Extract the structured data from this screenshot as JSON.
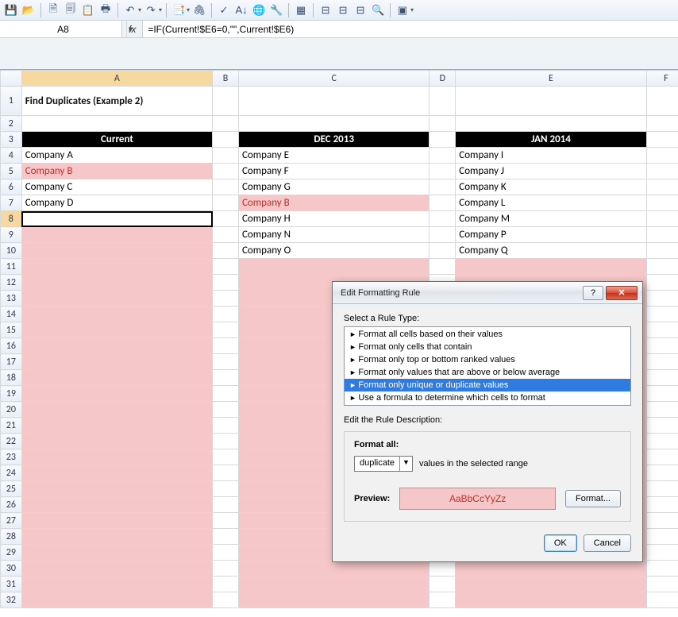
{
  "toolbar_icons": [
    "💾",
    "📂",
    "—",
    "📄",
    "📋",
    "📋",
    "🖨",
    "—",
    "↩",
    "↪",
    "—",
    "📑",
    "📎",
    "—",
    "✔",
    "🔤",
    "🌐",
    "🔧",
    "—",
    "🗂",
    "—",
    "🔗",
    "🔗",
    "🔀",
    "🔍",
    "—",
    "⬛"
  ],
  "name_box": "A8",
  "fx": "fx",
  "formula": "=IF(Current!$E6=0,\"\",Current!$E6)",
  "columns": [
    "A",
    "B",
    "C",
    "D",
    "E",
    "F"
  ],
  "rows": [
    "1",
    "2",
    "3",
    "4",
    "5",
    "6",
    "7",
    "8",
    "9",
    "10",
    "11",
    "12",
    "13",
    "14",
    "15",
    "16",
    "17",
    "18",
    "19",
    "20",
    "21",
    "22",
    "23",
    "24",
    "25",
    "26",
    "27",
    "28",
    "29",
    "30",
    "31",
    "32"
  ],
  "title": "Find Duplicates (Example 2)",
  "col_headers": {
    "A": "Current",
    "C": "DEC 2013",
    "E": "JAN 2014"
  },
  "cells": {
    "A4": "Company A",
    "C4": "Company E",
    "E4": "Company I",
    "A5": "Company B",
    "C5": "Company F",
    "E5": "Company J",
    "A6": "Company C",
    "C6": "Company G",
    "E6": "Company K",
    "A7": "Company D",
    "C7": "Company B",
    "E7": "Company L",
    "C8": "Company H",
    "E8": "Company M",
    "C9": "Company N",
    "E9": "Company P",
    "C10": "Company O",
    "E10": "Company Q"
  },
  "dialog": {
    "title": "Edit Formatting Rule",
    "select_label": "Select a Rule Type:",
    "rules": [
      "Format all cells based on their values",
      "Format only cells that contain",
      "Format only top or bottom ranked values",
      "Format only values that are above or below average",
      "Format only unique or duplicate values",
      "Use a formula to determine which cells to format"
    ],
    "selected_rule_index": 4,
    "desc_label": "Edit the Rule Description:",
    "format_all": "Format all:",
    "dropdown_value": "duplicate",
    "dropdown_suffix": "values in the selected range",
    "preview_label": "Preview:",
    "preview_text": "AaBbCcYyZz",
    "format_btn": "Format...",
    "ok": "OK",
    "cancel": "Cancel",
    "help": "?",
    "close": "✕"
  }
}
